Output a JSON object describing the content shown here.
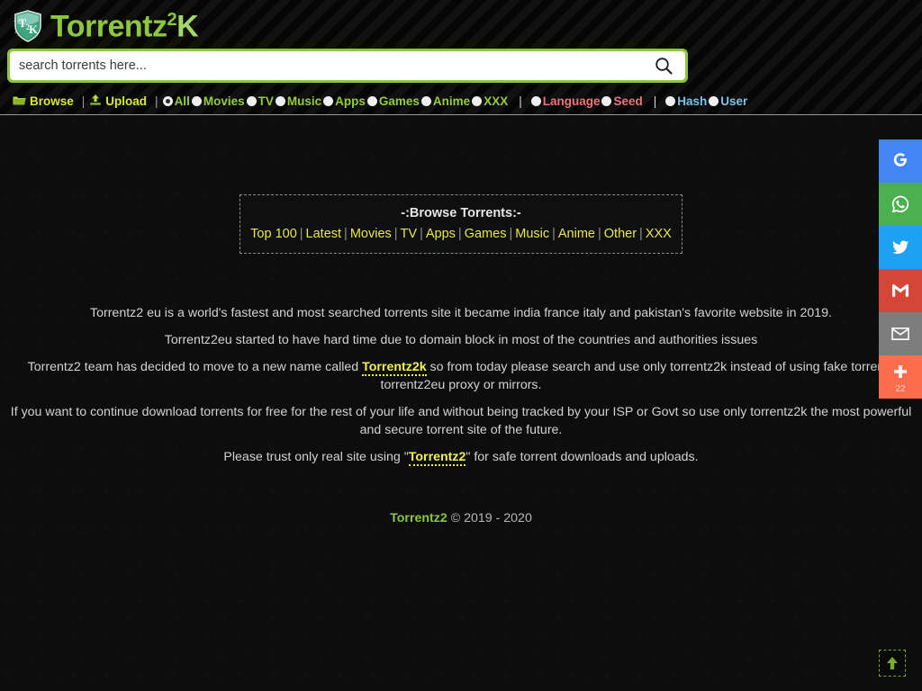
{
  "site": {
    "logo_text": "Torrentz",
    "logo_sup": "2",
    "logo_suffix": "K",
    "logo_badge": "T2K"
  },
  "search": {
    "placeholder": "search torrents here...",
    "value": "",
    "icon": "search-icon"
  },
  "nav": {
    "browse_label": "Browse",
    "upload_label": "Upload",
    "sep": "|",
    "categories": [
      {
        "label": "All",
        "checked": true,
        "style": "green"
      },
      {
        "label": "Movies",
        "checked": false,
        "style": "green"
      },
      {
        "label": "TV",
        "checked": false,
        "style": "green"
      },
      {
        "label": "Music",
        "checked": false,
        "style": "green"
      },
      {
        "label": "Apps",
        "checked": false,
        "style": "green"
      },
      {
        "label": "Games",
        "checked": false,
        "style": "green"
      },
      {
        "label": "Anime",
        "checked": false,
        "style": "green"
      },
      {
        "label": "XXX",
        "checked": false,
        "style": "green"
      }
    ],
    "filters": [
      {
        "label": "Language",
        "checked": false,
        "style": "red"
      },
      {
        "label": "Seed",
        "checked": false,
        "style": "red"
      }
    ],
    "lookups": [
      {
        "label": "Hash",
        "checked": false,
        "style": "blue"
      },
      {
        "label": "User",
        "checked": false,
        "style": "blue"
      }
    ]
  },
  "browse_box": {
    "title": "-:Browse Torrents:-",
    "links": [
      "Top 100",
      "Latest",
      "Movies",
      "TV",
      "Apps",
      "Games",
      "Music",
      "Anime",
      "Other",
      "XXX"
    ],
    "separator": "|"
  },
  "content": {
    "p1": "Torrentz2 eu is a world's fastest and most searched torrents site it became india france italy and pakistan's favorite website in 2019.",
    "p2": "Torrentz2eu started to have hard time due to domain block in most of the countries and authorities issues",
    "p3_before": "Torrentz2 team has decided to move to a new name called ",
    "p3_link": "Torrentz2k",
    "p3_after": " so from today please search and use only torrentz2k instead of using fake torrentz torrentz2eu proxy or mirrors.",
    "p4": "If you want to continue download torrents for free for the rest of your life and without being tracked by your ISP or Govt so use only torrentz2k the most powerful and secure torrent site of the future.",
    "p5_before": "Please trust only real site using \"",
    "p5_link": "Torrentz2",
    "p5_after": "\" for safe torrent downloads and uploads."
  },
  "footer": {
    "brand": "Torrentz2",
    "copyright": "© 2019 - 2020"
  },
  "social": {
    "items": [
      {
        "name": "google-icon",
        "color": "#4285f4"
      },
      {
        "name": "whatsapp-icon",
        "color": "#4caf50"
      },
      {
        "name": "twitter-icon",
        "color": "#1da1f2"
      },
      {
        "name": "gmail-icon",
        "color": "#d44638"
      },
      {
        "name": "email-icon",
        "color": "#7d7d7d"
      },
      {
        "name": "share-plus-icon",
        "color": "#fc6d4c",
        "count": "22"
      }
    ]
  },
  "scroll_top": {
    "label": "scroll-to-top"
  }
}
